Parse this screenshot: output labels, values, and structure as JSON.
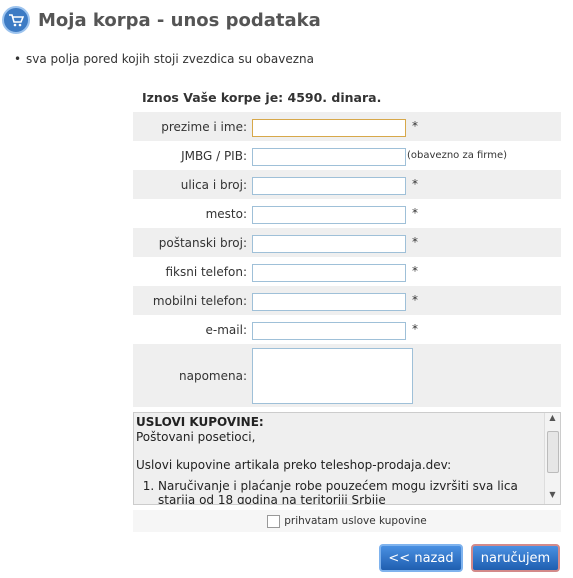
{
  "header": {
    "title": "Moja korpa - unos podataka",
    "icon": "cart-icon"
  },
  "note": "sva polja pored kojih stoji zvezdica su obavezna",
  "total": "Iznos Vaše korpe je: 4590. dinara.",
  "fields": [
    {
      "label": "prezime i ime:",
      "required": "*",
      "hint": ""
    },
    {
      "label": "JMBG / PIB:",
      "required": "",
      "hint": "(obavezno za firme)"
    },
    {
      "label": "ulica i broj:",
      "required": "*",
      "hint": ""
    },
    {
      "label": "mesto:",
      "required": "*",
      "hint": ""
    },
    {
      "label": "poštanski broj:",
      "required": "*",
      "hint": ""
    },
    {
      "label": "fiksni telefon:",
      "required": "*",
      "hint": ""
    },
    {
      "label": "mobilni telefon:",
      "required": "*",
      "hint": ""
    },
    {
      "label": "e-mail:",
      "required": "*",
      "hint": ""
    }
  ],
  "napomena_label": "napomena:",
  "terms": {
    "heading": "USLOVI KUPOVINE:",
    "greeting": "Poštovani posetioci,",
    "intro": "Uslovi kupovine artikala preko teleshop-prodaja.dev:",
    "item1": "Naručivanje i plaćanje robe pouzećem mogu izvršiti sva lica starija od 18 godina na teritoriji Srbije"
  },
  "agree_label": "prihvatam uslove kupovine",
  "buttons": {
    "back": "<< nazad",
    "order": "naručujem"
  }
}
